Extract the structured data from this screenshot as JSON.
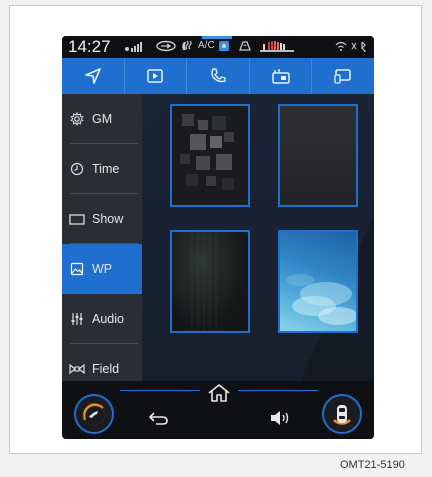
{
  "status_bar": {
    "time": "14:27",
    "ac_label": "A/C"
  },
  "nav_bar": {
    "items": [
      "navigation-icon",
      "media-icon",
      "phone-icon",
      "apps-icon",
      "projection-icon"
    ]
  },
  "side_menu": {
    "items": [
      {
        "label": "GM",
        "icon": "gear-icon"
      },
      {
        "label": "Time",
        "icon": "clock-icon"
      },
      {
        "label": "Show",
        "icon": "display-icon"
      },
      {
        "label": "WP",
        "icon": "wallpaper-icon"
      },
      {
        "label": "Audio",
        "icon": "equalizer-icon"
      },
      {
        "label": "Field",
        "icon": "sound-field-icon"
      }
    ],
    "active_index": 3
  },
  "wallpapers": [
    {
      "name": "dark-squares"
    },
    {
      "name": "gray-gradient"
    },
    {
      "name": "dark-vertical"
    },
    {
      "name": "blue-sky"
    }
  ],
  "bottom_bar": {
    "left_button_icon": "steering-wheel-icon",
    "home_icon": "home-icon",
    "back_icon": "back-icon",
    "volume_icon": "volume-icon",
    "right_button_icon": "car-icon"
  },
  "caption": "OMT21-5190",
  "colors": {
    "accent": "#1f6fcf",
    "background": "#16181d"
  }
}
